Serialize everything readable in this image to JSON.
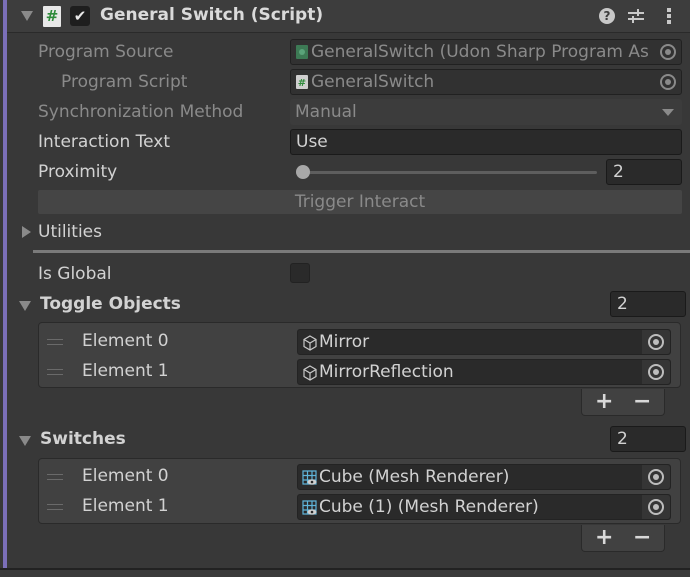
{
  "component": {
    "title": "General Switch (Script)",
    "enabled": true,
    "accent_color": "#7b6fb8"
  },
  "header_icons": {
    "fold": "fold-down-icon",
    "script": "script-icon",
    "help": "help-icon",
    "help_glyph": "?",
    "presets": "presets-icon",
    "menu": "kebab-menu-icon"
  },
  "properties": {
    "program_source": {
      "label": "Program Source",
      "value": "GeneralSwitch (Udon Sharp Program As"
    },
    "program_script": {
      "label": "Program Script",
      "value": "GeneralSwitch"
    },
    "sync_method": {
      "label": "Synchronization Method",
      "value": "Manual"
    },
    "interaction_text": {
      "label": "Interaction Text",
      "value": "Use"
    },
    "proximity": {
      "label": "Proximity",
      "value": "2",
      "slider_fraction": 0.02
    },
    "trigger_button": "Trigger Interact",
    "utilities": {
      "label": "Utilities",
      "expanded": false
    },
    "is_global": {
      "label": "Is Global",
      "checked": false
    }
  },
  "toggle_objects": {
    "label": "Toggle Objects",
    "size": "2",
    "items": [
      {
        "label": "Element 0",
        "value": "Mirror",
        "icon": "gameobject-cube-icon"
      },
      {
        "label": "Element 1",
        "value": "MirrorReflection",
        "icon": "gameobject-cube-icon"
      }
    ],
    "add": "+",
    "remove": "−"
  },
  "switches": {
    "label": "Switches",
    "size": "2",
    "items": [
      {
        "label": "Element 0",
        "value": "Cube (Mesh Renderer)",
        "icon": "mesh-renderer-icon"
      },
      {
        "label": "Element 1",
        "value": "Cube (1) (Mesh Renderer)",
        "icon": "mesh-renderer-icon"
      }
    ],
    "add": "+",
    "remove": "−"
  },
  "check_glyph": "✔"
}
